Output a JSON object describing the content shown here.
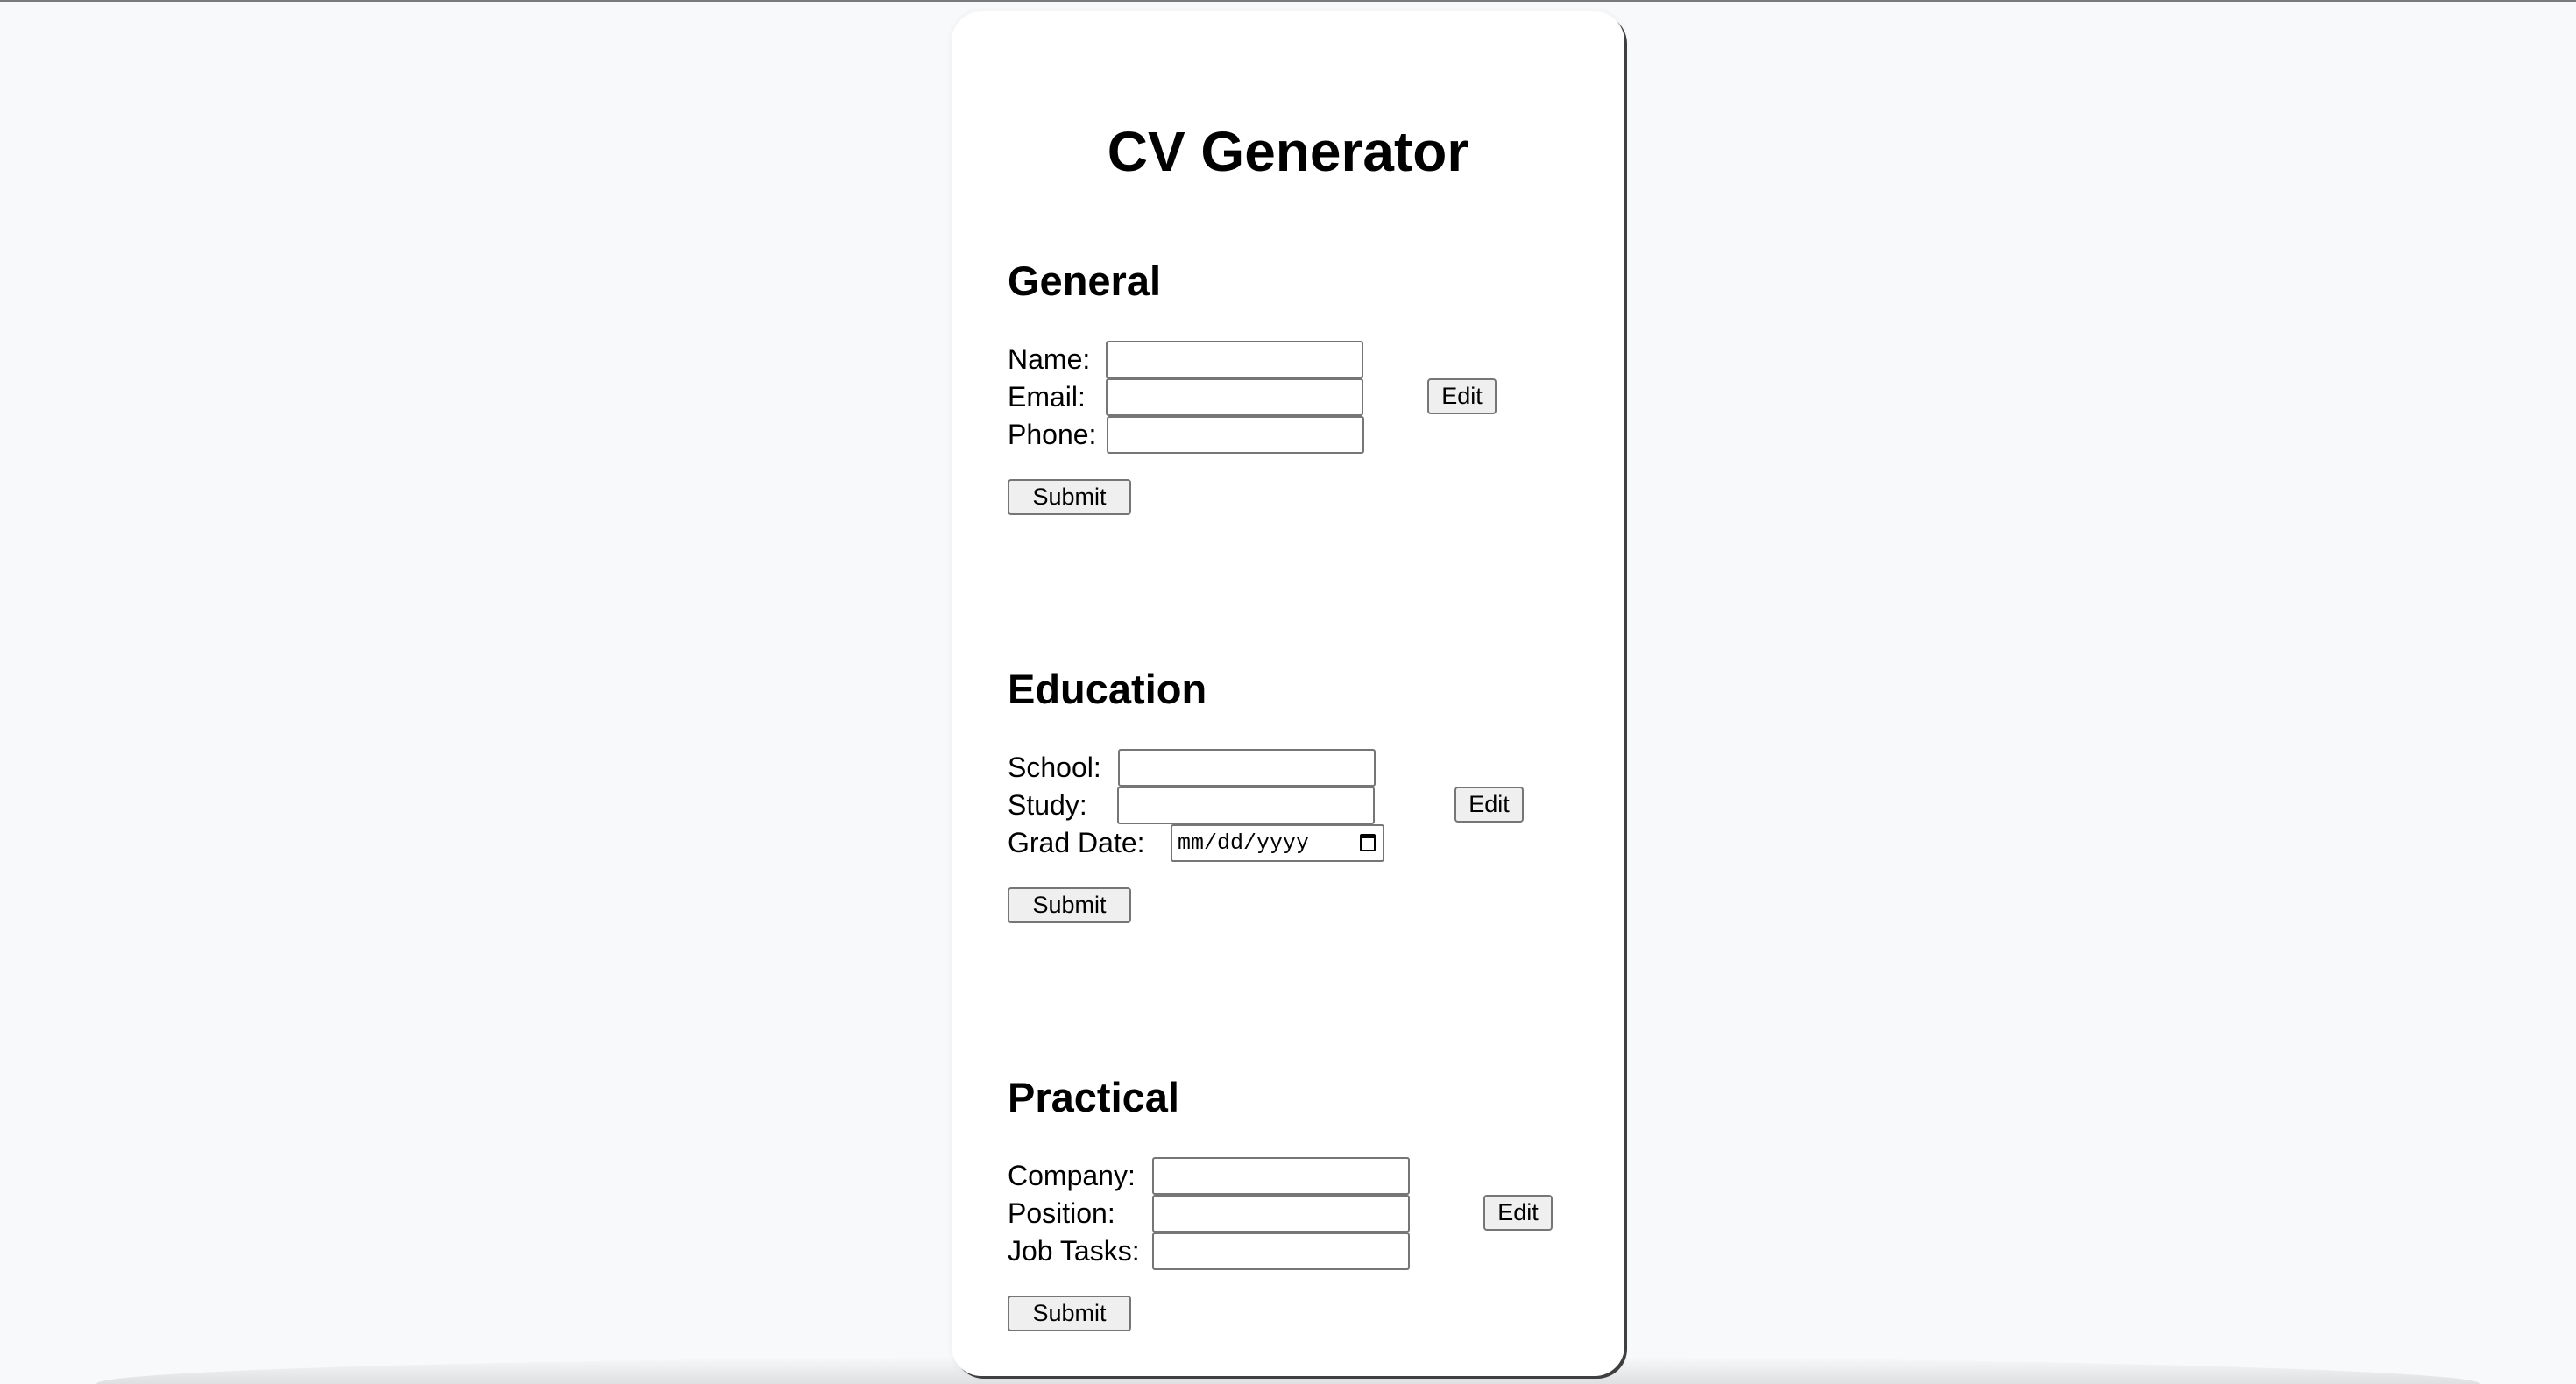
{
  "app": {
    "title": "CV Generator"
  },
  "sections": {
    "general": {
      "title": "General",
      "fields": {
        "name": {
          "label": "Name:",
          "value": ""
        },
        "email": {
          "label": "Email:",
          "value": ""
        },
        "phone": {
          "label": "Phone:",
          "value": ""
        }
      },
      "edit_label": "Edit",
      "submit_label": "Submit"
    },
    "education": {
      "title": "Education",
      "fields": {
        "school": {
          "label": "School:",
          "value": ""
        },
        "study": {
          "label": "Study:",
          "value": ""
        },
        "grad_date": {
          "label": "Grad Date:",
          "placeholder": "mm/dd/yyyy"
        }
      },
      "edit_label": "Edit",
      "submit_label": "Submit"
    },
    "practical": {
      "title": "Practical",
      "fields": {
        "company": {
          "label": "Company:",
          "value": ""
        },
        "position": {
          "label": "Position:",
          "value": ""
        },
        "job_tasks": {
          "label": "Job Tasks:",
          "value": ""
        }
      },
      "edit_label": "Edit",
      "submit_label": "Submit"
    }
  },
  "icons": {
    "date_picker": "calendar-icon"
  },
  "colors": {
    "page_background": "#f8f9fb",
    "card_background": "#ffffff",
    "button_background": "#efefef",
    "input_border": "#767676"
  }
}
